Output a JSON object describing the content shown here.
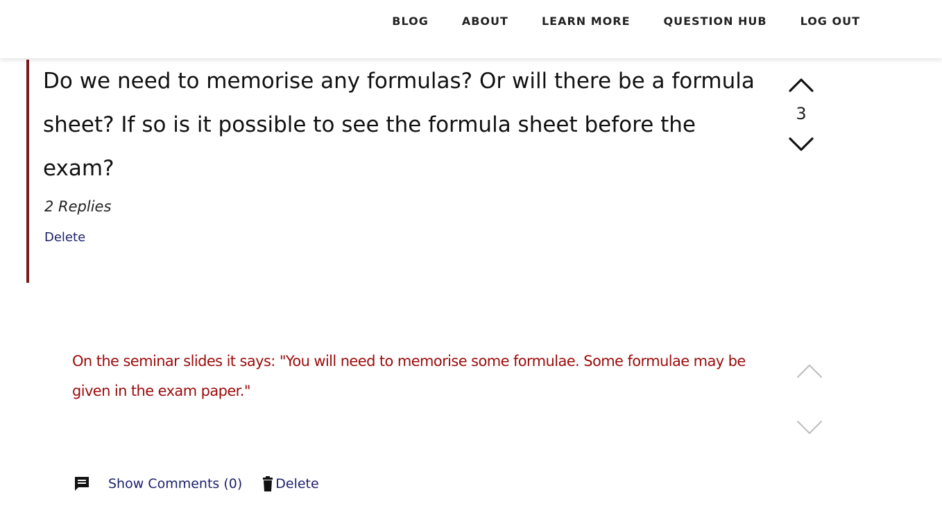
{
  "nav": {
    "items": [
      {
        "label": "BLOG"
      },
      {
        "label": "ABOUT"
      },
      {
        "label": "LEARN MORE"
      },
      {
        "label": "QUESTION HUB"
      },
      {
        "label": "LOG OUT"
      }
    ]
  },
  "question": {
    "text": "Do we need to memorise any formulas? Or will there be a formula sheet? If so is it possible to see the formula sheet before the exam?",
    "vote_count": "3",
    "replies_label": "2 Replies",
    "delete_label": "Delete",
    "accent_color": "#7a1a1a"
  },
  "answer": {
    "text": "On the seminar slides it says: \"You will need to memorise some formulae. Some formulae may be given in the exam paper.\"",
    "text_color": "#9b0a0a",
    "show_comments_label": "Show Comments (0)",
    "delete_label": "Delete",
    "link_color": "#1a1f6b"
  },
  "icons": {
    "upvote": "chevron-up-icon",
    "downvote": "chevron-down-icon",
    "comment": "comment-icon",
    "trash": "trash-icon"
  }
}
